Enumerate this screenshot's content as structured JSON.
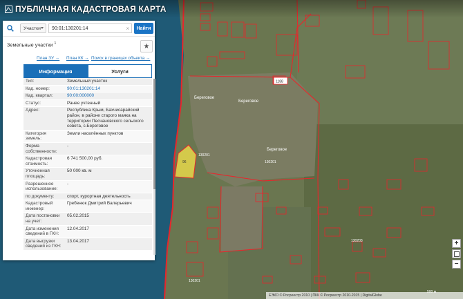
{
  "app": {
    "title": "ПУБЛИЧНАЯ КАДАСТРОВАЯ КАРТА"
  },
  "search": {
    "type_selected": "Участки",
    "query": "90:01:130201:14",
    "button": "Найти"
  },
  "panel": {
    "heading": "Земельные участки",
    "heading_count": "1",
    "links": [
      "План ЗУ →",
      "План КК →",
      "Поиск в границах объекта →"
    ],
    "tabs": [
      "Информация",
      "Услуги"
    ],
    "rows": [
      {
        "label": "Тип:",
        "value": "Земельный участок"
      },
      {
        "label": "Кад. номер:",
        "value": "90:01:130201:14"
      },
      {
        "label": "Кад. квартал:",
        "value": "90:00:000000"
      },
      {
        "label": "Статус:",
        "value": "Ранее учтенный"
      },
      {
        "label": "Адрес:",
        "value": "Республика Крым, Бахчисарайский район, в районе старого маяка на территории Песчановского сельского совета, с.Береговое"
      },
      {
        "label": "Категория земель:",
        "value": "Земли населённых пунктов"
      },
      {
        "label": "Форма собственности:",
        "value": "-"
      },
      {
        "label": "Кадастровая стоимость:",
        "value": "6 741 500,00 руб."
      },
      {
        "label": "Уточненная площадь:",
        "value": "50 000 кв. м"
      },
      {
        "label": "Разрешенное использование:",
        "value": "-"
      },
      {
        "label": "по документу:",
        "value": "спорт, курортная деятельность"
      },
      {
        "label": "Кадастровый инженер:",
        "value": "Гребенюк Дмитрий Валерьевич"
      },
      {
        "label": "Дата постановки на учет:",
        "value": "05.02.2015"
      },
      {
        "label": "Дата изменения сведений в ГКН:",
        "value": "12.04.2017"
      },
      {
        "label": "Дата выгрузки сведений из ГКН:",
        "value": "13.04.2017"
      }
    ]
  },
  "map": {
    "labels": [
      "Береговое",
      "Береговое",
      "Береговое"
    ],
    "plot_numbers": [
      "1188",
      "96",
      "130201",
      "130201",
      "130203",
      "130201"
    ],
    "colors": {
      "boundary": "#e8262b",
      "highlight": "#e6d84a",
      "sea": "#1f5a76",
      "field": "#5f6e45"
    }
  },
  "footer": {
    "copyright": "ЕЭКО © Росреестр 2010 | ПКК © Росреестр 2010-2015 | DigitalGlobe",
    "scale": "500 м"
  },
  "controls": {
    "zoom_in": "+",
    "zoom_out": "−"
  }
}
